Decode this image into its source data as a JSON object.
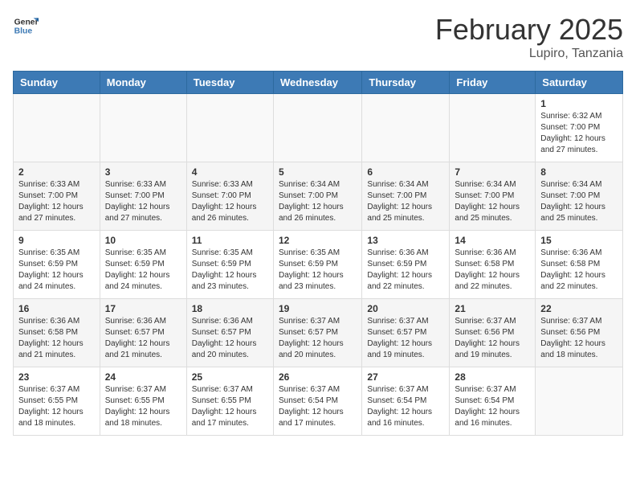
{
  "header": {
    "logo_line1": "General",
    "logo_line2": "Blue",
    "month_title": "February 2025",
    "location": "Lupiro, Tanzania"
  },
  "days_of_week": [
    "Sunday",
    "Monday",
    "Tuesday",
    "Wednesday",
    "Thursday",
    "Friday",
    "Saturday"
  ],
  "weeks": [
    [
      {
        "day": "",
        "sunrise": "",
        "sunset": "",
        "daylight": "",
        "empty": true
      },
      {
        "day": "",
        "sunrise": "",
        "sunset": "",
        "daylight": "",
        "empty": true
      },
      {
        "day": "",
        "sunrise": "",
        "sunset": "",
        "daylight": "",
        "empty": true
      },
      {
        "day": "",
        "sunrise": "",
        "sunset": "",
        "daylight": "",
        "empty": true
      },
      {
        "day": "",
        "sunrise": "",
        "sunset": "",
        "daylight": "",
        "empty": true
      },
      {
        "day": "",
        "sunrise": "",
        "sunset": "",
        "daylight": "",
        "empty": true
      },
      {
        "day": "1",
        "sunrise": "Sunrise: 6:32 AM",
        "sunset": "Sunset: 7:00 PM",
        "daylight": "Daylight: 12 hours and 27 minutes.",
        "empty": false
      }
    ],
    [
      {
        "day": "2",
        "sunrise": "Sunrise: 6:33 AM",
        "sunset": "Sunset: 7:00 PM",
        "daylight": "Daylight: 12 hours and 27 minutes.",
        "empty": false
      },
      {
        "day": "3",
        "sunrise": "Sunrise: 6:33 AM",
        "sunset": "Sunset: 7:00 PM",
        "daylight": "Daylight: 12 hours and 27 minutes.",
        "empty": false
      },
      {
        "day": "4",
        "sunrise": "Sunrise: 6:33 AM",
        "sunset": "Sunset: 7:00 PM",
        "daylight": "Daylight: 12 hours and 26 minutes.",
        "empty": false
      },
      {
        "day": "5",
        "sunrise": "Sunrise: 6:34 AM",
        "sunset": "Sunset: 7:00 PM",
        "daylight": "Daylight: 12 hours and 26 minutes.",
        "empty": false
      },
      {
        "day": "6",
        "sunrise": "Sunrise: 6:34 AM",
        "sunset": "Sunset: 7:00 PM",
        "daylight": "Daylight: 12 hours and 25 minutes.",
        "empty": false
      },
      {
        "day": "7",
        "sunrise": "Sunrise: 6:34 AM",
        "sunset": "Sunset: 7:00 PM",
        "daylight": "Daylight: 12 hours and 25 minutes.",
        "empty": false
      },
      {
        "day": "8",
        "sunrise": "Sunrise: 6:34 AM",
        "sunset": "Sunset: 7:00 PM",
        "daylight": "Daylight: 12 hours and 25 minutes.",
        "empty": false
      }
    ],
    [
      {
        "day": "9",
        "sunrise": "Sunrise: 6:35 AM",
        "sunset": "Sunset: 6:59 PM",
        "daylight": "Daylight: 12 hours and 24 minutes.",
        "empty": false
      },
      {
        "day": "10",
        "sunrise": "Sunrise: 6:35 AM",
        "sunset": "Sunset: 6:59 PM",
        "daylight": "Daylight: 12 hours and 24 minutes.",
        "empty": false
      },
      {
        "day": "11",
        "sunrise": "Sunrise: 6:35 AM",
        "sunset": "Sunset: 6:59 PM",
        "daylight": "Daylight: 12 hours and 23 minutes.",
        "empty": false
      },
      {
        "day": "12",
        "sunrise": "Sunrise: 6:35 AM",
        "sunset": "Sunset: 6:59 PM",
        "daylight": "Daylight: 12 hours and 23 minutes.",
        "empty": false
      },
      {
        "day": "13",
        "sunrise": "Sunrise: 6:36 AM",
        "sunset": "Sunset: 6:59 PM",
        "daylight": "Daylight: 12 hours and 22 minutes.",
        "empty": false
      },
      {
        "day": "14",
        "sunrise": "Sunrise: 6:36 AM",
        "sunset": "Sunset: 6:58 PM",
        "daylight": "Daylight: 12 hours and 22 minutes.",
        "empty": false
      },
      {
        "day": "15",
        "sunrise": "Sunrise: 6:36 AM",
        "sunset": "Sunset: 6:58 PM",
        "daylight": "Daylight: 12 hours and 22 minutes.",
        "empty": false
      }
    ],
    [
      {
        "day": "16",
        "sunrise": "Sunrise: 6:36 AM",
        "sunset": "Sunset: 6:58 PM",
        "daylight": "Daylight: 12 hours and 21 minutes.",
        "empty": false
      },
      {
        "day": "17",
        "sunrise": "Sunrise: 6:36 AM",
        "sunset": "Sunset: 6:57 PM",
        "daylight": "Daylight: 12 hours and 21 minutes.",
        "empty": false
      },
      {
        "day": "18",
        "sunrise": "Sunrise: 6:36 AM",
        "sunset": "Sunset: 6:57 PM",
        "daylight": "Daylight: 12 hours and 20 minutes.",
        "empty": false
      },
      {
        "day": "19",
        "sunrise": "Sunrise: 6:37 AM",
        "sunset": "Sunset: 6:57 PM",
        "daylight": "Daylight: 12 hours and 20 minutes.",
        "empty": false
      },
      {
        "day": "20",
        "sunrise": "Sunrise: 6:37 AM",
        "sunset": "Sunset: 6:57 PM",
        "daylight": "Daylight: 12 hours and 19 minutes.",
        "empty": false
      },
      {
        "day": "21",
        "sunrise": "Sunrise: 6:37 AM",
        "sunset": "Sunset: 6:56 PM",
        "daylight": "Daylight: 12 hours and 19 minutes.",
        "empty": false
      },
      {
        "day": "22",
        "sunrise": "Sunrise: 6:37 AM",
        "sunset": "Sunset: 6:56 PM",
        "daylight": "Daylight: 12 hours and 18 minutes.",
        "empty": false
      }
    ],
    [
      {
        "day": "23",
        "sunrise": "Sunrise: 6:37 AM",
        "sunset": "Sunset: 6:55 PM",
        "daylight": "Daylight: 12 hours and 18 minutes.",
        "empty": false
      },
      {
        "day": "24",
        "sunrise": "Sunrise: 6:37 AM",
        "sunset": "Sunset: 6:55 PM",
        "daylight": "Daylight: 12 hours and 18 minutes.",
        "empty": false
      },
      {
        "day": "25",
        "sunrise": "Sunrise: 6:37 AM",
        "sunset": "Sunset: 6:55 PM",
        "daylight": "Daylight: 12 hours and 17 minutes.",
        "empty": false
      },
      {
        "day": "26",
        "sunrise": "Sunrise: 6:37 AM",
        "sunset": "Sunset: 6:54 PM",
        "daylight": "Daylight: 12 hours and 17 minutes.",
        "empty": false
      },
      {
        "day": "27",
        "sunrise": "Sunrise: 6:37 AM",
        "sunset": "Sunset: 6:54 PM",
        "daylight": "Daylight: 12 hours and 16 minutes.",
        "empty": false
      },
      {
        "day": "28",
        "sunrise": "Sunrise: 6:37 AM",
        "sunset": "Sunset: 6:54 PM",
        "daylight": "Daylight: 12 hours and 16 minutes.",
        "empty": false
      },
      {
        "day": "",
        "sunrise": "",
        "sunset": "",
        "daylight": "",
        "empty": true
      }
    ]
  ]
}
